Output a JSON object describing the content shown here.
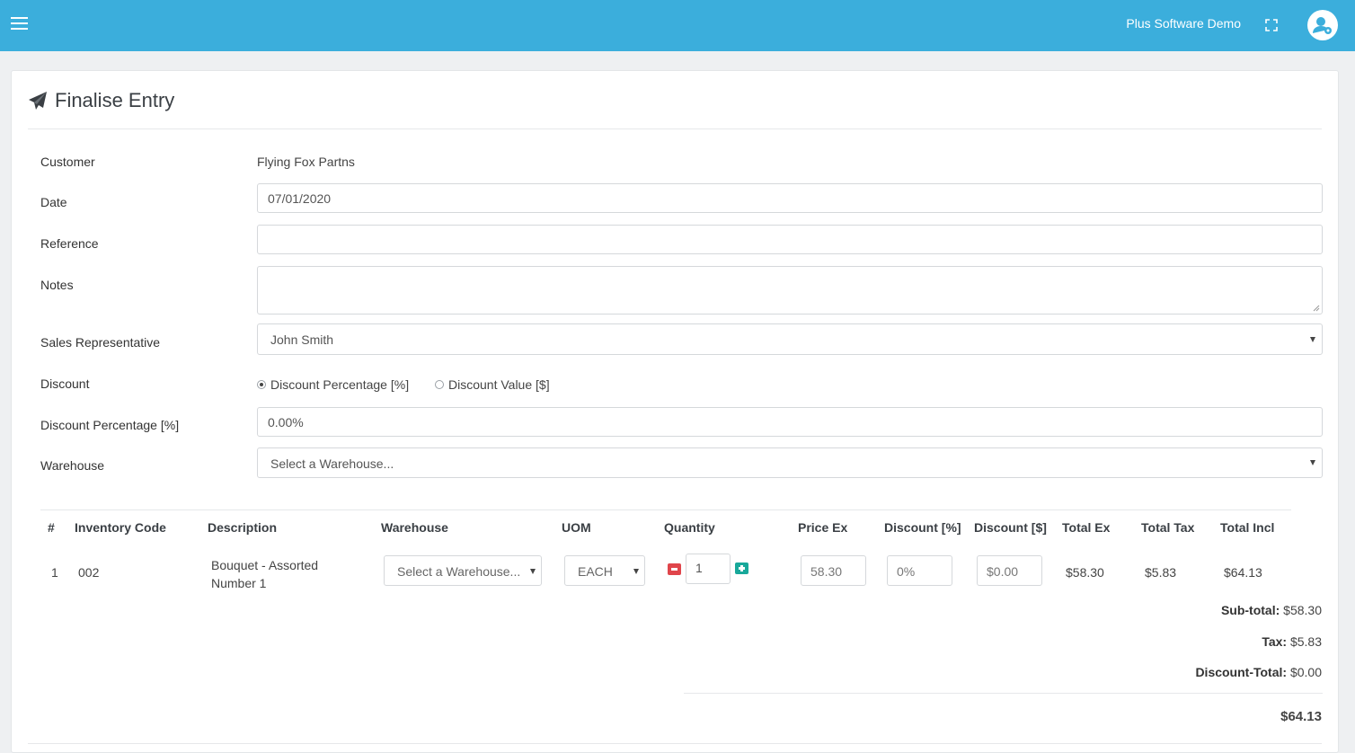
{
  "header": {
    "brand": "Plus Software Demo",
    "bar_color": "#3baedc",
    "menu_icon": "hamburger-icon",
    "expand_icon": "fullscreen-icon",
    "avatar_icon": "user-settings-icon"
  },
  "page": {
    "title": "Finalise Entry",
    "title_icon": "paper-plane-icon"
  },
  "form": {
    "customer_label": "Customer",
    "customer_value": "Flying Fox Partns",
    "date_label": "Date",
    "date_value": "07/01/2020",
    "reference_label": "Reference",
    "reference_value": "",
    "notes_label": "Notes",
    "notes_value": "",
    "sales_rep_label": "Sales Representative",
    "sales_rep_value": "John Smith",
    "discount_label": "Discount",
    "discount_option_percent": "Discount Percentage [%]",
    "discount_option_value": "Discount Value [$]",
    "discount_pct_label": "Discount Percentage [%]",
    "discount_pct_value": "0.00%",
    "warehouse_label": "Warehouse",
    "warehouse_placeholder": "Select a Warehouse..."
  },
  "table": {
    "headers": [
      "#",
      "Inventory Code",
      "Description",
      "Warehouse",
      "UOM",
      "Quantity",
      "Price Ex",
      "Discount [%]",
      "Discount [$]",
      "Total Ex",
      "Total Tax",
      "Total Incl"
    ],
    "rows": [
      {
        "num": "1",
        "code": "002",
        "description_line1": "Bouquet - Assorted",
        "description_line2": "Number 1",
        "warehouse": "Select a Warehouse...",
        "uom": "EACH",
        "quantity": "1",
        "price_ex": "58.30",
        "discount_pct": "0%",
        "discount_val": "$0.00",
        "total_ex": "$58.30",
        "total_tax": "$5.83",
        "total_incl": "$64.13"
      }
    ]
  },
  "summary": {
    "subtotal_label": "Sub-total:",
    "subtotal_value": "$58.30",
    "tax_label": "Tax:",
    "tax_value": "$5.83",
    "discount_total_label": "Discount-Total:",
    "discount_total_value": "$0.00",
    "grand_total": "$64.13"
  }
}
